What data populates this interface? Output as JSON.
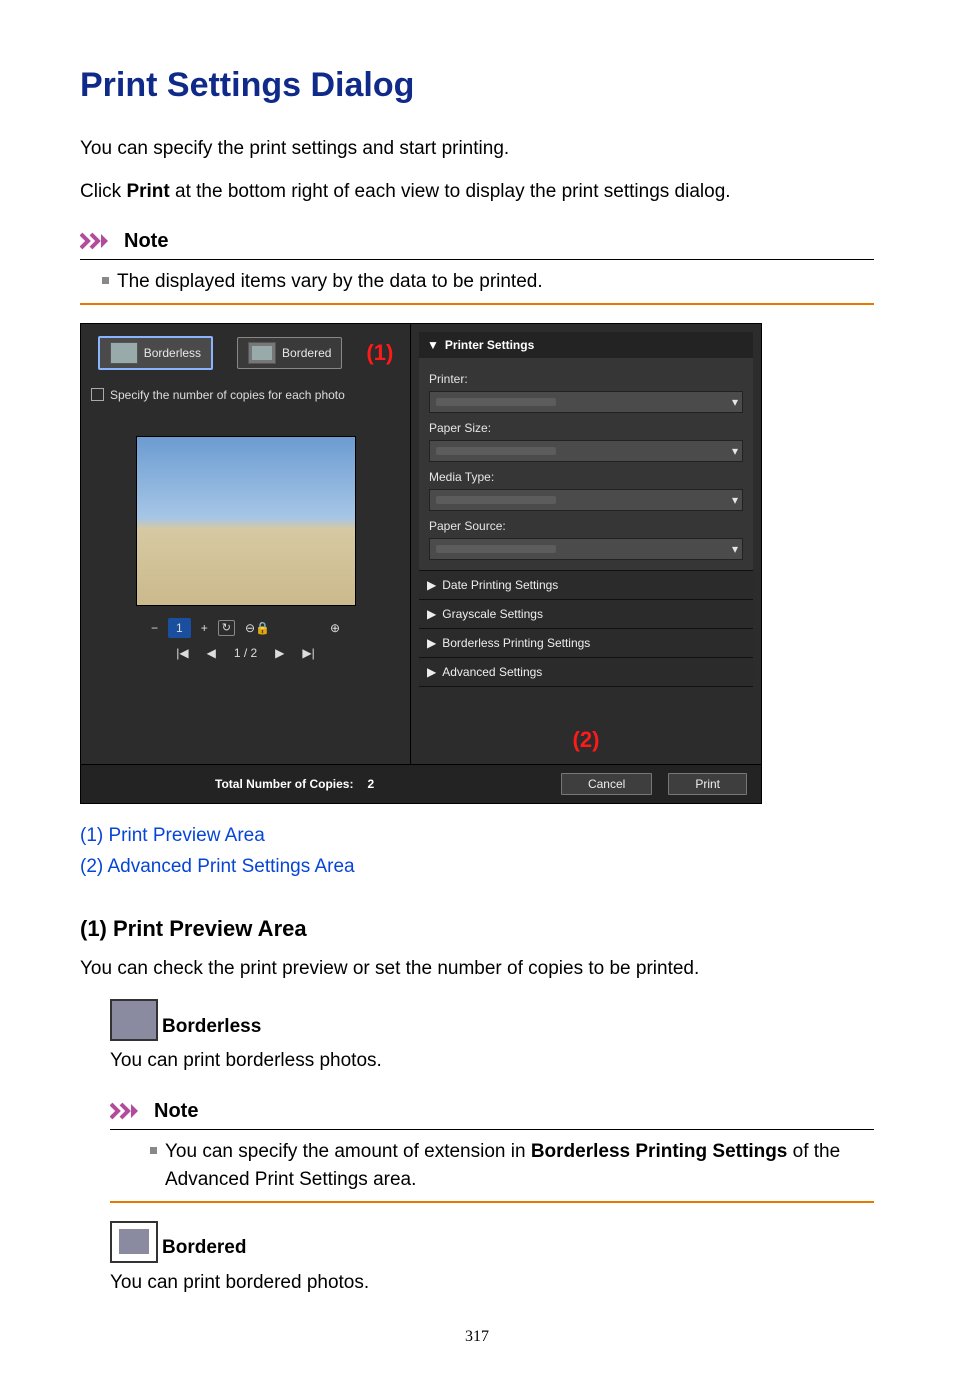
{
  "title": "Print Settings Dialog",
  "intro1_a": "You can specify the print settings and start printing.",
  "intro2_a": "Click ",
  "intro2_b": "Print",
  "intro2_c": " at the bottom right of each view to display the print settings dialog.",
  "note_label": "Note",
  "note1_text": "The displayed items vary by the data to be printed.",
  "shot": {
    "tab_borderless": "Borderless",
    "tab_bordered": "Bordered",
    "callout1": "(1)",
    "chk_label": "Specify the number of copies for each photo",
    "ctrl_minus": "−",
    "ctrl_count": "1",
    "ctrl_plus": "+",
    "ctrl_refresh": "↻",
    "ctrl_trash": "⊖🔒",
    "ctrl_zoom": "⊕",
    "nav_first": "|◀",
    "nav_prev": "◀",
    "nav_page": "1 / 2",
    "nav_next": "▶",
    "nav_last": "▶|",
    "panel_title": "Printer Settings",
    "f_printer": "Printer:",
    "f_paper_size": "Paper Size:",
    "f_media_type": "Media Type:",
    "f_paper_source": "Paper Source:",
    "s_date": "Date Printing Settings",
    "s_gray": "Grayscale Settings",
    "s_borderless": "Borderless Printing Settings",
    "s_adv": "Advanced Settings",
    "callout2": "(2)",
    "total_label": "Total Number of Copies:",
    "total_value": "2",
    "btn_cancel": "Cancel",
    "btn_print": "Print"
  },
  "anchors": {
    "a1": "(1) Print Preview Area",
    "a2": "(2) Advanced Print Settings Area"
  },
  "sec1_title": "(1) Print Preview Area",
  "sec1_intro": "You can check the print preview or set the number of copies to be printed.",
  "item_borderless_title": "Borderless",
  "item_borderless_desc": "You can print borderless photos.",
  "note2_a": "You can specify the amount of extension in ",
  "note2_b": "Borderless Printing Settings",
  "note2_c": " of the Advanced Print Settings area.",
  "item_bordered_title": "Bordered",
  "item_bordered_desc": "You can print bordered photos.",
  "page_number": "317"
}
